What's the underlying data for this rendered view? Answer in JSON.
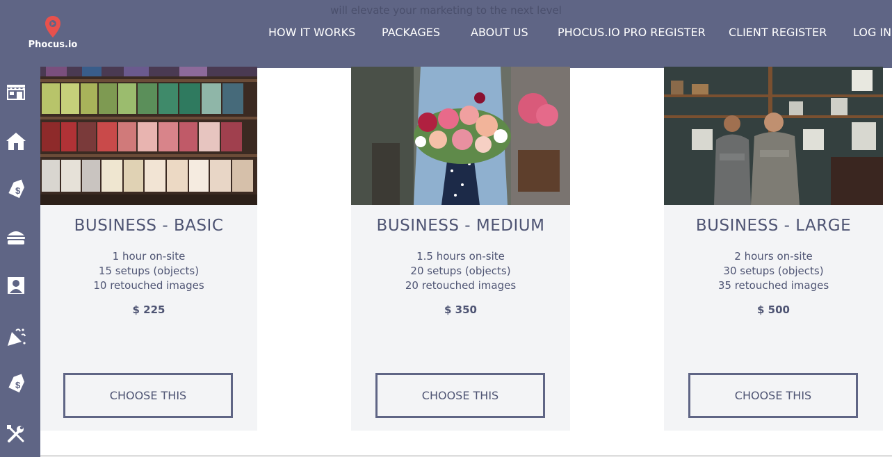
{
  "header": {
    "tagline": "will elevate your marketing to the next level",
    "logo_text": "Phocus.io",
    "nav": [
      {
        "label": "HOW IT WORKS"
      },
      {
        "label": "PACKAGES"
      },
      {
        "label": "ABOUT US"
      },
      {
        "label": "PHOCUS.IO PRO REGISTER"
      },
      {
        "label": "CLIENT REGISTER"
      },
      {
        "label": "LOG IN"
      }
    ]
  },
  "sidebar": {
    "icons": [
      "storefront-icon",
      "home-icon",
      "price-tag-icon",
      "burger-icon",
      "portrait-icon",
      "party-icon",
      "price-tag-icon",
      "tools-icon"
    ]
  },
  "packages": [
    {
      "title": "BUSINESS - BASIC",
      "features": [
        "1 hour on-site",
        "15 setups (objects)",
        "10 retouched images"
      ],
      "price": "$ 225",
      "button": "CHOOSE THIS"
    },
    {
      "title": "BUSINESS - MEDIUM",
      "features": [
        "1.5 hours on-site",
        "20 setups (objects)",
        "20 retouched images"
      ],
      "price": "$ 350",
      "button": "CHOOSE THIS"
    },
    {
      "title": "BUSINESS - LARGE",
      "features": [
        "2 hours on-site",
        "30 setups (objects)",
        "35 retouched images"
      ],
      "price": "$ 500",
      "button": "CHOOSE THIS"
    }
  ],
  "colors": {
    "header_bg": "#5f6585",
    "card_bg": "#f3f4f6",
    "text": "#4e5473",
    "logo_accent": "#e8514d"
  }
}
